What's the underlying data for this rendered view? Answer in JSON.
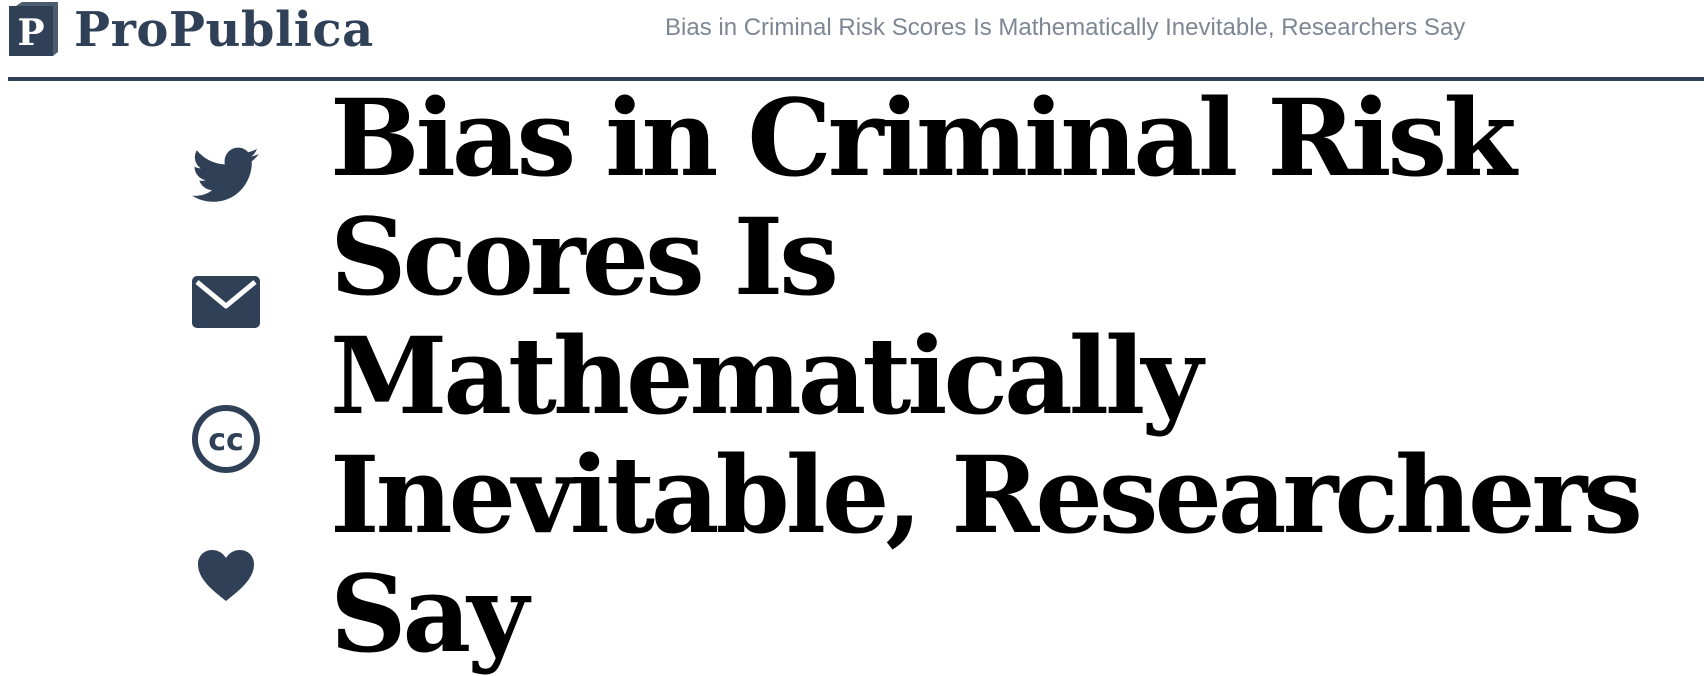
{
  "site": {
    "logo_mark": "P",
    "logo_text": "ProPublica",
    "story_title": "Bias in Criminal Risk Scores Is Mathematically Inevitable, Researchers Say"
  },
  "article": {
    "headline": "Bias in Criminal Risk Scores Is Mathematically Inevitable, Researchers Say"
  },
  "share": {
    "cc_text": "cc",
    "icons": [
      "twitter-icon",
      "envelope-icon",
      "creative-commons-icon",
      "heart-icon"
    ]
  },
  "colors": {
    "brand": "#2f4057",
    "muted_text": "#7d8793",
    "headline": "#000000"
  }
}
